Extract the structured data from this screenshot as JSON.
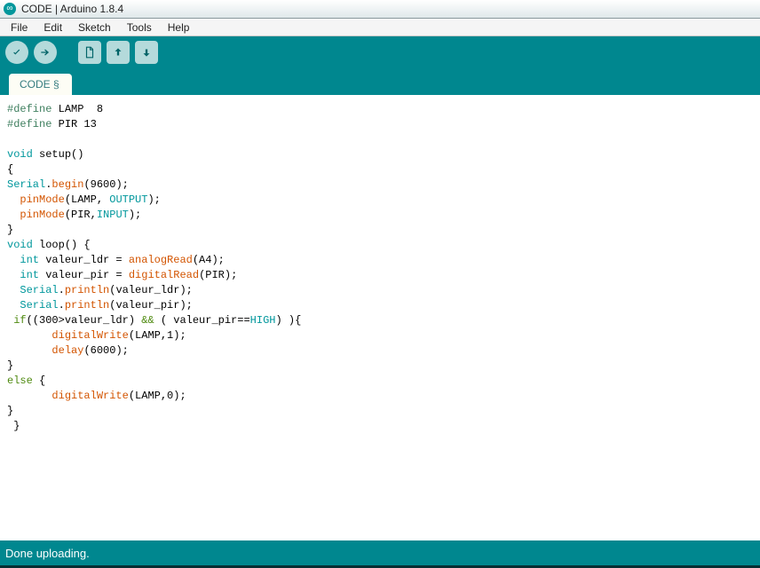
{
  "titlebar": {
    "text": "CODE | Arduino 1.8.4"
  },
  "menubar": {
    "items": [
      "File",
      "Edit",
      "Sketch",
      "Tools",
      "Help"
    ]
  },
  "toolbar": {
    "buttons": [
      {
        "name": "verify-button",
        "icon": "check"
      },
      {
        "name": "upload-button",
        "icon": "arrow-right"
      },
      {
        "name": "new-button",
        "icon": "file"
      },
      {
        "name": "open-button",
        "icon": "arrow-up"
      },
      {
        "name": "save-button",
        "icon": "arrow-down"
      }
    ]
  },
  "tabs": [
    {
      "label": "CODE §"
    }
  ],
  "code": {
    "lines": [
      [
        {
          "cls": "tok-define",
          "t": "#define"
        },
        {
          "t": " LAMP  8"
        }
      ],
      [
        {
          "cls": "tok-define",
          "t": "#define"
        },
        {
          "t": " PIR 13"
        }
      ],
      [
        {
          "t": " "
        }
      ],
      [
        {
          "cls": "tok-type",
          "t": "void"
        },
        {
          "t": " setup()"
        }
      ],
      [
        {
          "t": "{"
        }
      ],
      [
        {
          "cls": "tok-serial",
          "t": "Serial"
        },
        {
          "t": "."
        },
        {
          "cls": "tok-func",
          "t": "begin"
        },
        {
          "t": "(9600);"
        }
      ],
      [
        {
          "t": "  "
        },
        {
          "cls": "tok-func",
          "t": "pinMode"
        },
        {
          "t": "(LAMP, "
        },
        {
          "cls": "tok-const",
          "t": "OUTPUT"
        },
        {
          "t": ");"
        }
      ],
      [
        {
          "t": "  "
        },
        {
          "cls": "tok-func",
          "t": "pinMode"
        },
        {
          "t": "(PIR,"
        },
        {
          "cls": "tok-const",
          "t": "INPUT"
        },
        {
          "t": ");"
        }
      ],
      [
        {
          "t": "}"
        }
      ],
      [
        {
          "cls": "tok-type",
          "t": "void"
        },
        {
          "t": " loop() {"
        }
      ],
      [
        {
          "t": "  "
        },
        {
          "cls": "tok-type",
          "t": "int"
        },
        {
          "t": " valeur_ldr = "
        },
        {
          "cls": "tok-func",
          "t": "analogRead"
        },
        {
          "t": "(A4);"
        }
      ],
      [
        {
          "t": "  "
        },
        {
          "cls": "tok-type",
          "t": "int"
        },
        {
          "t": " valeur_pir = "
        },
        {
          "cls": "tok-func",
          "t": "digitalRead"
        },
        {
          "t": "(PIR);"
        }
      ],
      [
        {
          "t": "  "
        },
        {
          "cls": "tok-serial",
          "t": "Serial"
        },
        {
          "t": "."
        },
        {
          "cls": "tok-func",
          "t": "println"
        },
        {
          "t": "(valeur_ldr);"
        }
      ],
      [
        {
          "t": "  "
        },
        {
          "cls": "tok-serial",
          "t": "Serial"
        },
        {
          "t": "."
        },
        {
          "cls": "tok-func",
          "t": "println"
        },
        {
          "t": "(valeur_pir);"
        }
      ],
      [
        {
          "t": " "
        },
        {
          "cls": "tok-kw",
          "t": "if"
        },
        {
          "t": "((300>valeur_ldr) "
        },
        {
          "cls": "tok-kw",
          "t": "&&"
        },
        {
          "t": " ( valeur_pir=="
        },
        {
          "cls": "tok-const",
          "t": "HIGH"
        },
        {
          "t": ") ){"
        }
      ],
      [
        {
          "t": "       "
        },
        {
          "cls": "tok-func",
          "t": "digitalWrite"
        },
        {
          "t": "(LAMP,1);"
        }
      ],
      [
        {
          "t": "       "
        },
        {
          "cls": "tok-func",
          "t": "delay"
        },
        {
          "t": "(6000);"
        }
      ],
      [
        {
          "t": "}"
        }
      ],
      [
        {
          "cls": "tok-kw",
          "t": "else"
        },
        {
          "t": " {"
        }
      ],
      [
        {
          "t": "       "
        },
        {
          "cls": "tok-func",
          "t": "digitalWrite"
        },
        {
          "t": "(LAMP,0);"
        }
      ],
      [
        {
          "t": "}"
        }
      ],
      [
        {
          "t": " }"
        }
      ]
    ]
  },
  "status": {
    "text": "Done uploading."
  }
}
